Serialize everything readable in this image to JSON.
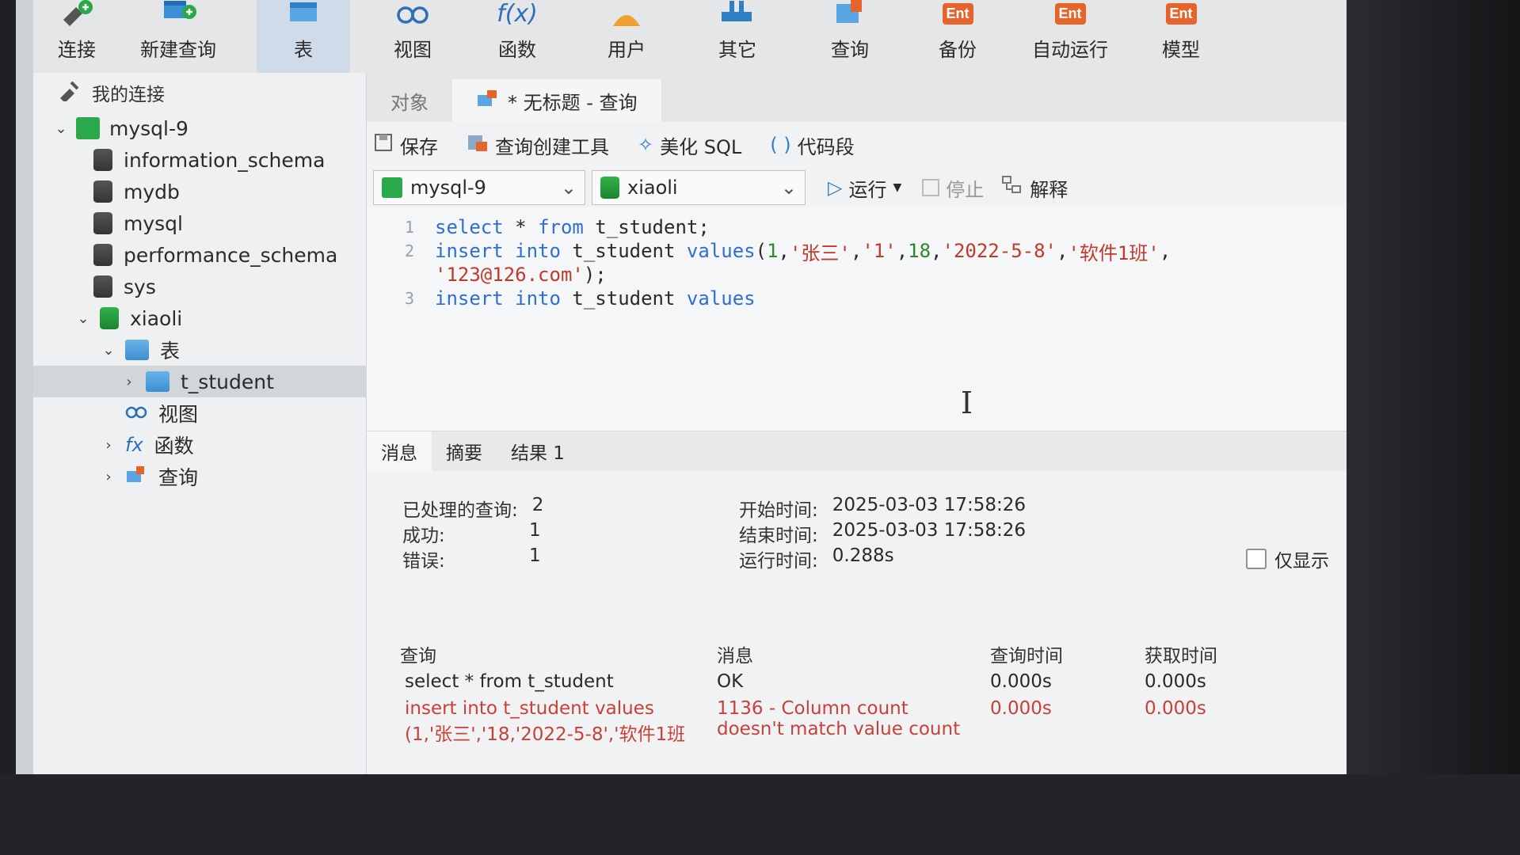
{
  "toolbar": {
    "items": [
      {
        "label": "连接",
        "icon": "connect-icon"
      },
      {
        "label": "新建查询",
        "icon": "new-query-icon"
      },
      {
        "label": "表",
        "icon": "table-icon"
      },
      {
        "label": "视图",
        "icon": "view-icon"
      },
      {
        "label": "函数",
        "icon": "function-icon"
      },
      {
        "label": "用户",
        "icon": "user-icon"
      },
      {
        "label": "其它",
        "icon": "other-icon"
      },
      {
        "label": "查询",
        "icon": "query-icon"
      },
      {
        "label": "备份",
        "icon": "backup-icon"
      },
      {
        "label": "自动运行",
        "icon": "automation-icon"
      },
      {
        "label": "模型",
        "icon": "model-icon"
      }
    ],
    "function_glyph": "f(x)",
    "ent_badge": "Ent"
  },
  "sidebar": {
    "header": "我的连接",
    "tree": [
      {
        "label": "mysql-9"
      },
      {
        "label": "information_schema"
      },
      {
        "label": "mydb"
      },
      {
        "label": "mysql"
      },
      {
        "label": "performance_schema"
      },
      {
        "label": "sys"
      },
      {
        "label": "xiaoli"
      },
      {
        "label": "表"
      },
      {
        "label": "t_student"
      },
      {
        "label": "视图"
      },
      {
        "label": "函数"
      },
      {
        "label": "查询"
      }
    ]
  },
  "tabs": {
    "objects": "对象",
    "query_tab": "* 无标题 - 查询"
  },
  "editor_toolbar": {
    "save": "保存",
    "query_builder": "查询创建工具",
    "beautify": "美化 SQL",
    "snippet": "代码段",
    "snippet_glyph": "( )",
    "run": "运行",
    "stop": "停止",
    "explain": "解释"
  },
  "selectors": {
    "connection": "mysql-9",
    "database": "xiaoli"
  },
  "editor": {
    "line_numbers": [
      "1",
      "2",
      "3"
    ],
    "l1_kw1": "select",
    "l1_rest1": " * ",
    "l1_kw2": "from",
    "l1_rest2": " t_student;",
    "l2_kw1": "insert",
    "l2_kw2": "into",
    "l2_tbl": " t_student ",
    "l2_kw3": "values",
    "l2_p1": "(",
    "l2_n1": "1",
    "l2_c1": ",",
    "l2_s1": "'张三'",
    "l2_c2": ",",
    "l2_s2": "'1'",
    "l2_c3": ",",
    "l2_n2": "18",
    "l2_c4": ",",
    "l2_s3": "'2022-5-8'",
    "l2_c5": ",",
    "l2_s4": "'软件1班'",
    "l2_c6": ",",
    "l2b_s5": "'123@126.com'",
    "l2b_end": ");",
    "l3_kw1": "insert",
    "l3_kw2": "into",
    "l3_tbl": " t_student ",
    "l3_kw3": "values"
  },
  "result_tabs": [
    "消息",
    "摘要",
    "结果 1"
  ],
  "summary": {
    "processed_label": "已处理的查询:",
    "processed_value": "2",
    "success_label": "成功:",
    "success_value": "1",
    "error_label": "错误:",
    "error_value": "1",
    "start_label": "开始时间:",
    "start_value": "2025-03-03 17:58:26",
    "end_label": "结束时间:",
    "end_value": "2025-03-03 17:58:26",
    "runtime_label": "运行时间:",
    "runtime_value": "0.288s",
    "only_show_label": "仅显示"
  },
  "results_table": {
    "headers": [
      "查询",
      "消息",
      "查询时间",
      "获取时间"
    ],
    "rows": [
      {
        "query": "select * from t_student",
        "message": "OK",
        "query_time": "0.000s",
        "fetch_time": "0.000s"
      },
      {
        "query": "insert into t_student values(1,'张三','18,'2022-5-8','软件1班",
        "message": "1136 - Column count doesn't match value count",
        "query_time": "0.000s",
        "fetch_time": "0.000s"
      }
    ]
  },
  "colors": {
    "accent": "#2e6fd0",
    "error": "#c8403a",
    "ent_orange": "#e8632a",
    "active_tab": "#cfdbe8"
  }
}
